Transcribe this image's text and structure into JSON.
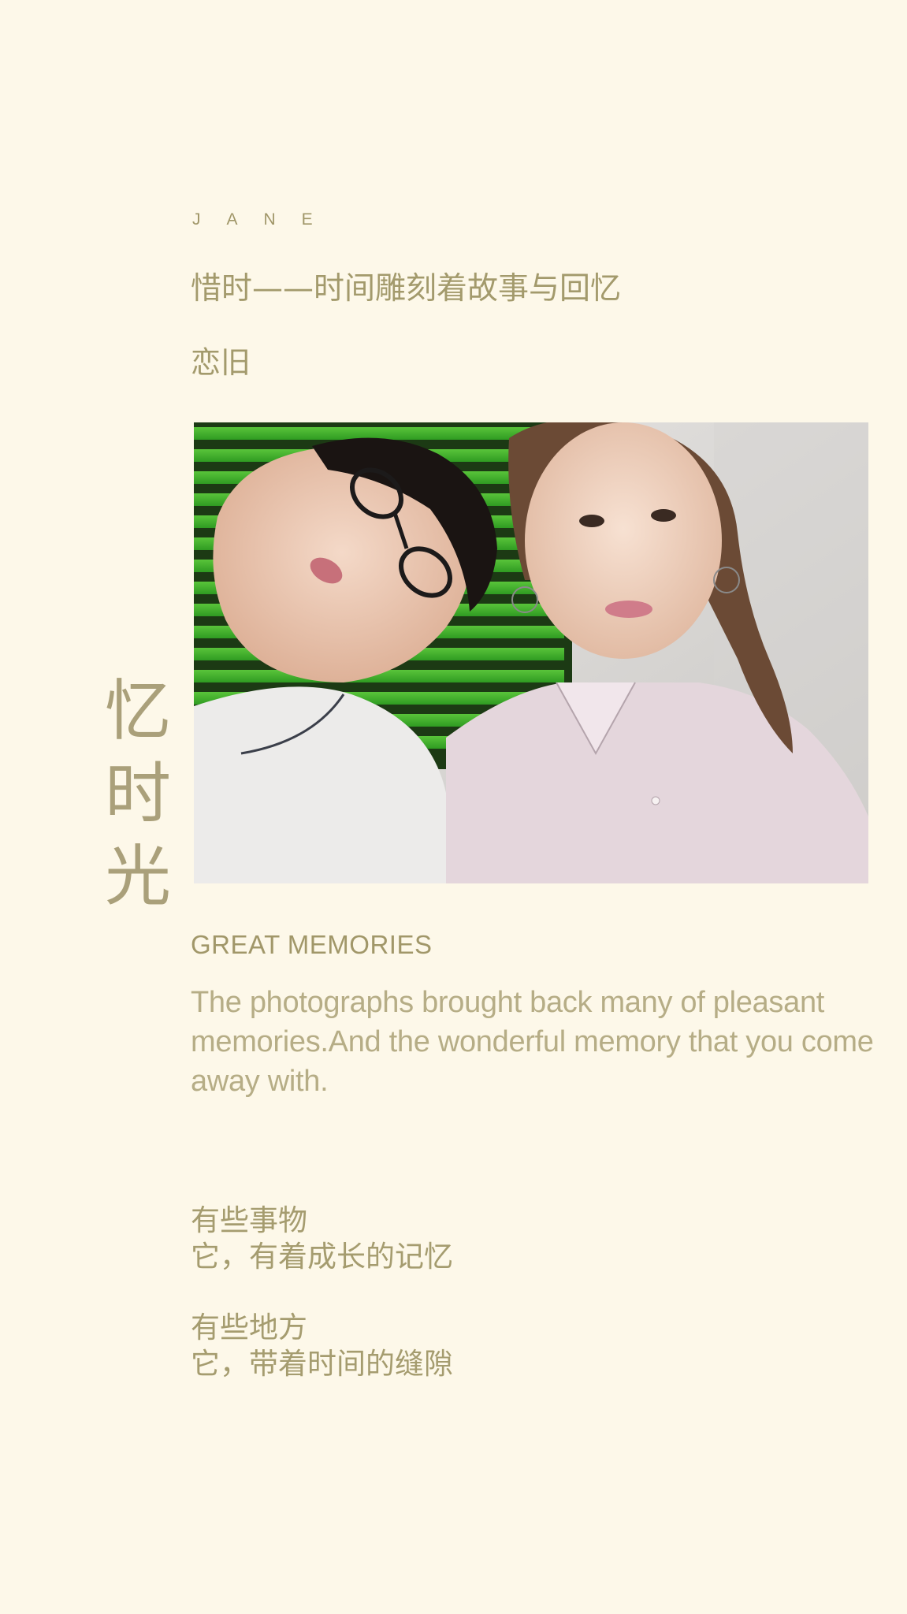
{
  "header": {
    "name": "JANE",
    "headline": "惜时——时间雕刻着故事与回忆",
    "sub_headline": "恋旧"
  },
  "vertical_title": [
    "忆",
    "时",
    "光"
  ],
  "photo": {
    "description_icon": "photo-image"
  },
  "section": {
    "title": "GREAT MEMORIES",
    "body": "The photographs brought back many of pleasant memories.And the wonderful memory that you come away with."
  },
  "poem": {
    "stanza1": [
      "有些事物",
      "它，有着成长的记忆"
    ],
    "stanza2": [
      "有些地方",
      "它，带着时间的缝隙"
    ]
  },
  "colors": {
    "background": "#fdf8e9",
    "text": "#a39a6c",
    "body_text": "#b6ad86"
  }
}
